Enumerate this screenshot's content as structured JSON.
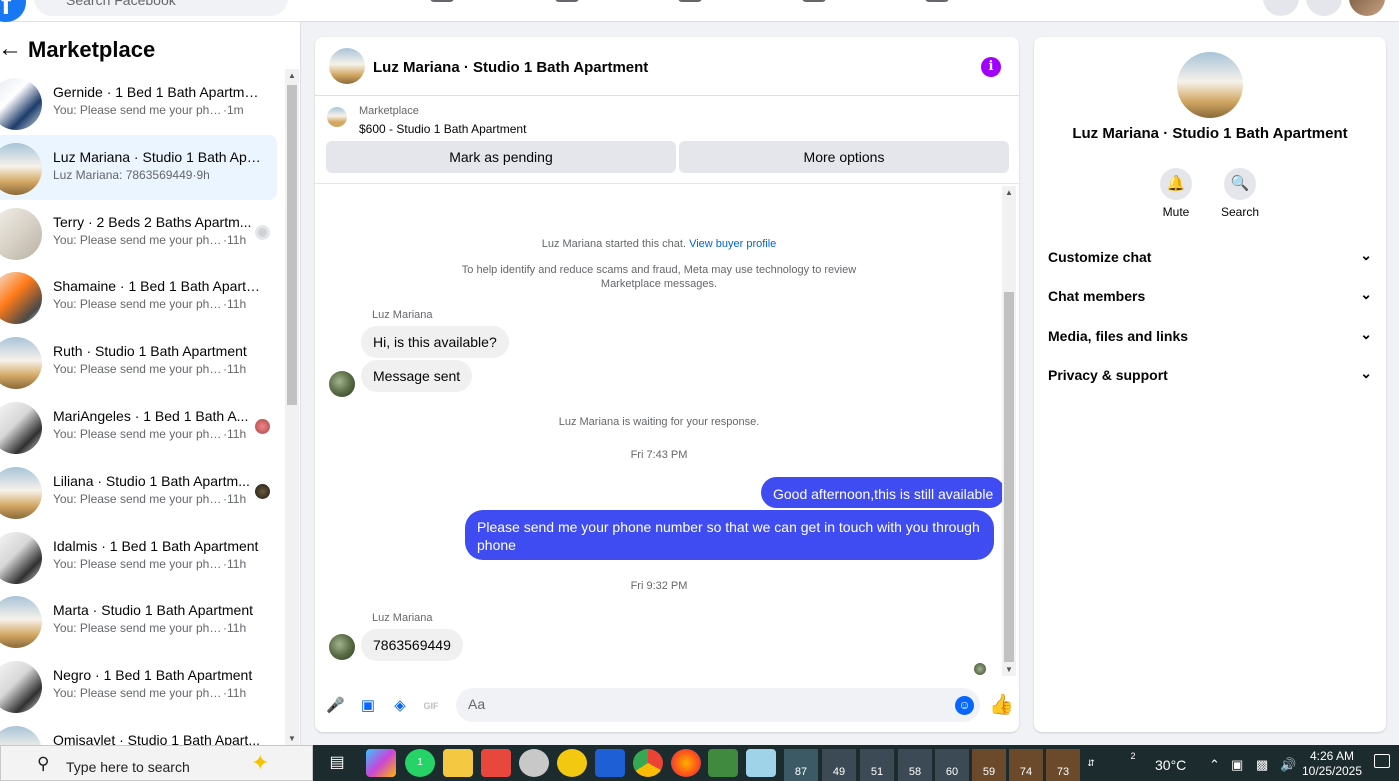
{
  "topbar": {
    "logo_letter": "f",
    "search_placeholder": "Search Facebook"
  },
  "sidebar": {
    "title": "Marketplace",
    "conversations": [
      {
        "title": "Gernide · 1 Bed 1 Bath Apartment",
        "message": "You: Please send me your phone ...",
        "time": "·1m"
      },
      {
        "title": "Luz Mariana · Studio 1 Bath Apa...",
        "message": "Luz Mariana: 7863569449",
        "time": "·9h"
      },
      {
        "title": "Terry · 2 Beds 2 Baths Apartm...",
        "message": "You: Please send me your pho...",
        "time": "·11h"
      },
      {
        "title": "Shamaine · 1 Bed 1 Bath Apartm...",
        "message": "You: Please send me your phone ...",
        "time": "·11h"
      },
      {
        "title": "Ruth · Studio 1 Bath Apartment",
        "message": "You: Please send me your phone ...",
        "time": "·11h"
      },
      {
        "title": "MariAngeles · 1 Bed 1 Bath A...",
        "message": "You: Please send me your pho...",
        "time": "·11h"
      },
      {
        "title": "Liliana · Studio 1 Bath Apartm...",
        "message": "You: Please send me your pho...",
        "time": "·11h"
      },
      {
        "title": "Idalmis · 1 Bed 1 Bath Apartment",
        "message": "You: Please send me your phone ...",
        "time": "·11h"
      },
      {
        "title": "Marta · Studio 1 Bath Apartment",
        "message": "You: Please send me your phone ...",
        "time": "·11h"
      },
      {
        "title": "Negro · 1 Bed 1 Bath Apartment",
        "message": "You: Please send me your phone ...",
        "time": "·11h"
      },
      {
        "title": "Omisaylet · Studio 1 Bath Apart...",
        "message": "",
        "time": ""
      }
    ]
  },
  "chat": {
    "title": "Luz Mariana · Studio 1 Bath Apartment",
    "info_icon": "i",
    "listing_label": "Marketplace",
    "listing_price": "$600 - Studio 1 Bath Apartment",
    "btn_pending": "Mark as pending",
    "btn_more": "More options",
    "started_text": "Luz Mariana started this chat.",
    "view_profile": "View buyer profile",
    "scam_notice_line1": "To help identify and reduce scams and fraud, Meta may use technology to review",
    "scam_notice_line2": "Marketplace messages.",
    "sender1": "Luz Mariana",
    "msg_in_1": "Hi, is this available?",
    "msg_in_2": "Message sent",
    "waiting_text": "Luz Mariana is waiting for your response.",
    "time_1": "Fri 7:43 PM",
    "msg_out_1": "Good afternoon,this is still available",
    "msg_out_2": "Please send me your phone  number so that we can get in touch with you through phone",
    "time_2": "Fri 9:32 PM",
    "sender2": "Luz Mariana",
    "msg_in_3": "7863569449",
    "composer_placeholder": "Aa",
    "gif_label": "GIF"
  },
  "rpanel": {
    "title": "Luz Mariana · Studio 1 Bath Apartment",
    "mute_label": "Mute",
    "search_label": "Search",
    "items": [
      "Customize chat",
      "Chat members",
      "Media, files and links",
      "Privacy & support"
    ]
  },
  "taskbar": {
    "search_text": "Type here to search",
    "whatsapp_badge": "1",
    "weather_badges": [
      "87",
      "49",
      "51",
      "58",
      "60",
      "59",
      "74",
      "73"
    ],
    "weather_count": "2",
    "temperature": "30°C",
    "time": "4:26 AM",
    "date": "10/25/2025"
  },
  "colors": {
    "accent_blue": "#0866ff",
    "outgoing_bubble": "#3f4cf1",
    "info_purple": "#a100ff",
    "active_conversation": "#ebf5ff"
  }
}
